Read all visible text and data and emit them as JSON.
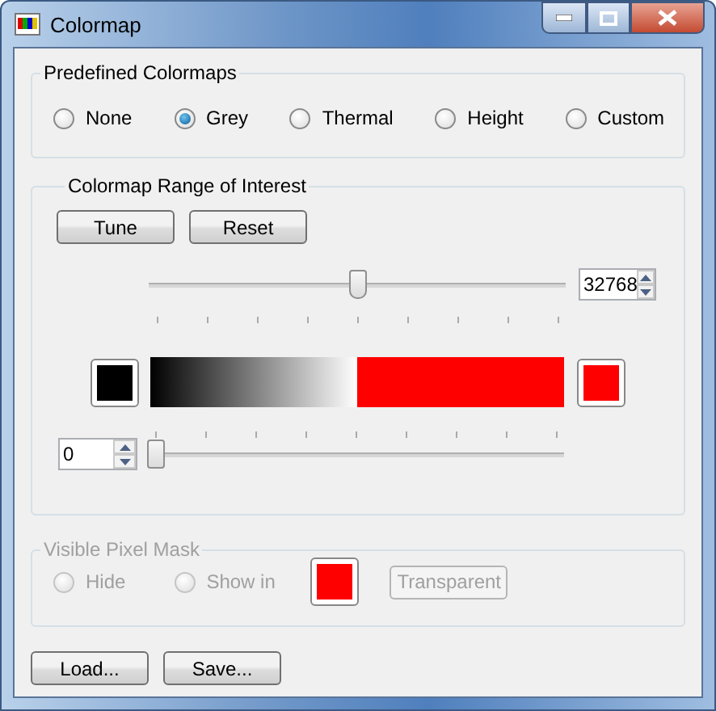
{
  "window": {
    "title": "Colormap"
  },
  "predefined": {
    "title": "Predefined Colormaps",
    "options": [
      {
        "label": "None",
        "selected": false
      },
      {
        "label": "Grey",
        "selected": true
      },
      {
        "label": "Thermal",
        "selected": false
      },
      {
        "label": "Height",
        "selected": false
      },
      {
        "label": "Custom",
        "selected": false
      }
    ]
  },
  "range": {
    "title": "Colormap Range of Interest",
    "buttons": [
      "Tune",
      "Reset"
    ],
    "upper": {
      "value": "32768",
      "level": 0.5
    },
    "low_swatch": {
      "color": "#000000"
    },
    "high_swatch": {
      "color": "#ff0000"
    },
    "lower": {
      "value": "0",
      "level": 0
    }
  },
  "mask": {
    "title": "Visible Pixel Mask",
    "disabled": true,
    "options": [
      {
        "label": "Hide",
        "selected": false
      },
      {
        "label": "Show in",
        "selected": false
      }
    ],
    "color": "#ff0000",
    "button": "Transparent"
  },
  "buttons": [
    "Load...",
    "Save..."
  ]
}
